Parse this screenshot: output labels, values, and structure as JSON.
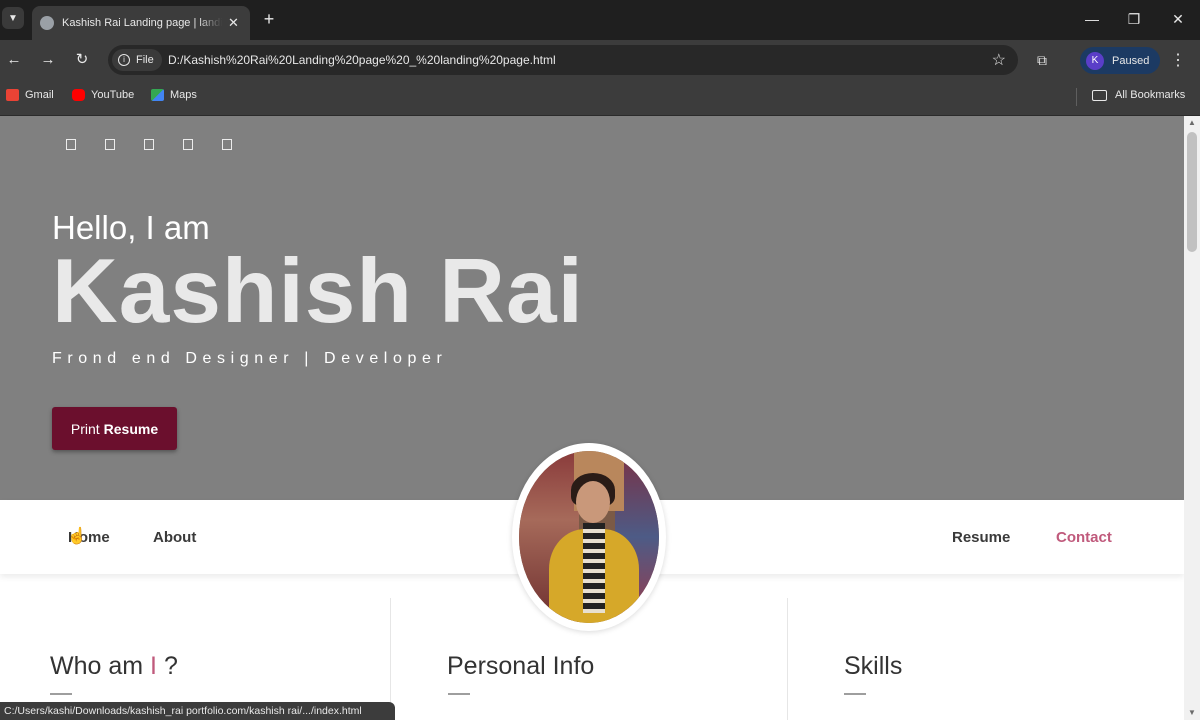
{
  "browser": {
    "tab_title": "Kashish Rai Landing page | landing",
    "url_chip": "File",
    "url": "D:/Kashish%20Rai%20Landing%20page%20_%20landing%20page.html",
    "profile_initial": "K",
    "profile_status": "Paused",
    "bookmarks": [
      "Gmail",
      "YouTube",
      "Maps"
    ],
    "all_bookmarks": "All Bookmarks",
    "status_url": "C:/Users/kashi/Downloads/kashish_rai portfolio.com/kashish rai/.../index.html"
  },
  "hero": {
    "greeting": "Hello, I am",
    "name": "Kashish Rai",
    "role": "Frond end Designer | Developer",
    "button_prefix": "Print",
    "button_bold": "Resume"
  },
  "nav": {
    "home": "Home",
    "about": "About",
    "resume": "Resume",
    "contact": "Contact"
  },
  "sections": {
    "who_prefix": "Who am",
    "who_accent": "I",
    "who_suffix": "?",
    "personal": "Personal Info",
    "skills": "Skills"
  },
  "colors": {
    "hero_bg": "#808080",
    "button_bg": "#6b0f2d",
    "accent": "#c05a7c"
  }
}
